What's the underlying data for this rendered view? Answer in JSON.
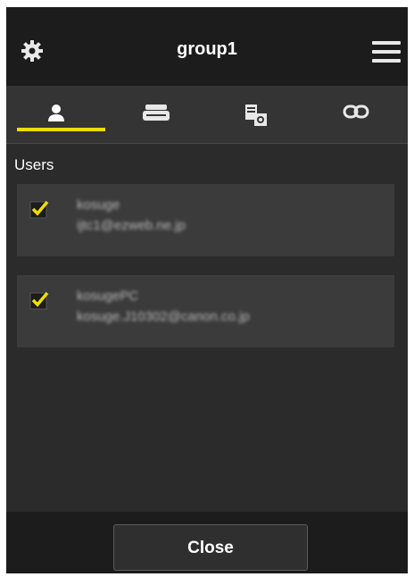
{
  "header": {
    "title": "group1",
    "left_icon": "gear-icon",
    "right_icon": "hamburger-menu-icon"
  },
  "tabs": [
    {
      "icon": "user-icon",
      "selected": true
    },
    {
      "icon": "printer-icon",
      "selected": false
    },
    {
      "icon": "app-settings-icon",
      "selected": false
    },
    {
      "icon": "link-icon",
      "selected": false
    }
  ],
  "users_section": {
    "label": "Users",
    "items": [
      {
        "name": "kosuge",
        "email": "ijtc1@ezweb.ne.jp",
        "checked": true
      },
      {
        "name": "kosugePC",
        "email": "kosuge.J10302@canon.co.jp",
        "checked": true
      }
    ]
  },
  "footer": {
    "close_label": "Close"
  },
  "colors": {
    "accent": "#f0de00",
    "background": "#2b2b2b",
    "header": "#1c1c1c",
    "card": "#3b3b3b"
  }
}
